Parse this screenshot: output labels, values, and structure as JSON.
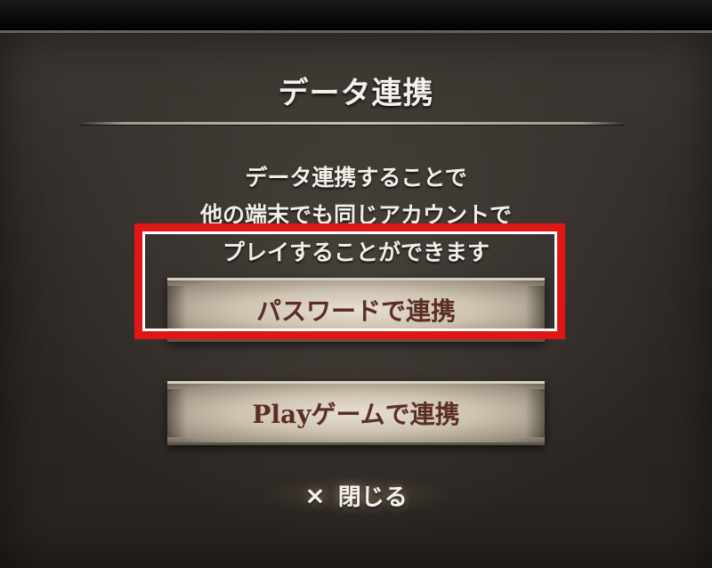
{
  "dialog": {
    "title": "データ連携",
    "description_lines": [
      "データ連携することで",
      "他の端末でも同じアカウントで",
      "プレイすることができます"
    ]
  },
  "buttons": {
    "password_label": "パスワードで連携",
    "play_label": "Playゲームで連携",
    "close_label": "閉じる",
    "close_icon": "×"
  },
  "colors": {
    "highlight": "#e01616",
    "button_text": "#5a2e26"
  }
}
